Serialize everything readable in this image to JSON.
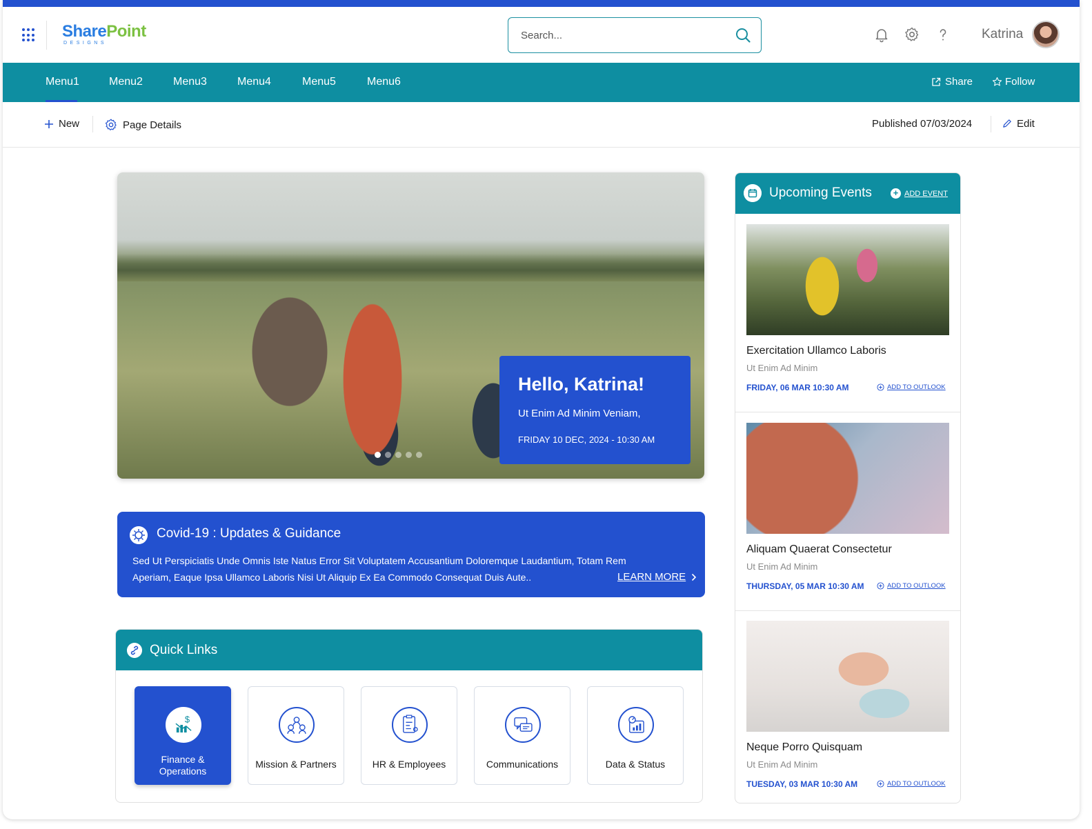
{
  "header": {
    "logo_primary": "Share",
    "logo_secondary": "Point",
    "logo_sub": "DESIGNS",
    "search_placeholder": "Search...",
    "user_name": "Katrina"
  },
  "nav": {
    "menus": [
      "Menu1",
      "Menu2",
      "Menu3",
      "Menu4",
      "Menu5",
      "Menu6"
    ],
    "share_label": "Share",
    "follow_label": "Follow"
  },
  "command_bar": {
    "new_label": "New",
    "page_details_label": "Page Details",
    "published_label": "Published 07/03/2024",
    "edit_label": "Edit"
  },
  "hero": {
    "greeting": "Hello, Katrina!",
    "subtitle": "Ut Enim Ad Minim Veniam,",
    "date": "FRIDAY 10 DEC, 2024 - 10:30 AM",
    "slide_count": 5,
    "active_slide": 1
  },
  "covid": {
    "title": "Covid-19 : Updates & Guidance",
    "body": "Sed Ut Perspiciatis Unde Omnis Iste Natus Error Sit Voluptatem Accusantium Doloremque Laudantium, Totam Rem Aperiam, Eaque Ipsa Ullamco Laboris Nisi Ut Aliquip Ex Ea Commodo Consequat Duis Aute..",
    "learn_more": "LEARN MORE"
  },
  "quick_links": {
    "title": "Quick Links",
    "items": [
      {
        "label": "Finance & Operations",
        "icon": "finance-icon",
        "active": true
      },
      {
        "label": "Mission & Partners",
        "icon": "partners-icon",
        "active": false
      },
      {
        "label": "HR & Employees",
        "icon": "hr-icon",
        "active": false
      },
      {
        "label": "Communications",
        "icon": "chat-icon",
        "active": false
      },
      {
        "label": "Data & Status",
        "icon": "data-icon",
        "active": false
      }
    ]
  },
  "events": {
    "title": "Upcoming Events",
    "add_label": "ADD EVENT",
    "items": [
      {
        "title": "Exercitation Ullamco Laboris",
        "subtitle": "Ut Enim Ad Minim",
        "date": "FRIDAY, 06 MAR 10:30 AM",
        "action": "ADD TO OUTLOOK"
      },
      {
        "title": "Aliquam Quaerat Consectetur",
        "subtitle": "Ut Enim Ad Minim",
        "date": "THURSDAY, 05 MAR 10:30 AM",
        "action": "ADD TO OUTLOOK"
      },
      {
        "title": "Neque Porro Quisquam",
        "subtitle": "Ut Enim Ad Minim",
        "date": "TUESDAY, 03 MAR 10:30 AM",
        "action": "ADD TO OUTLOOK"
      }
    ]
  },
  "colors": {
    "brand_blue": "#2351cf",
    "teal": "#0e8ea1"
  }
}
